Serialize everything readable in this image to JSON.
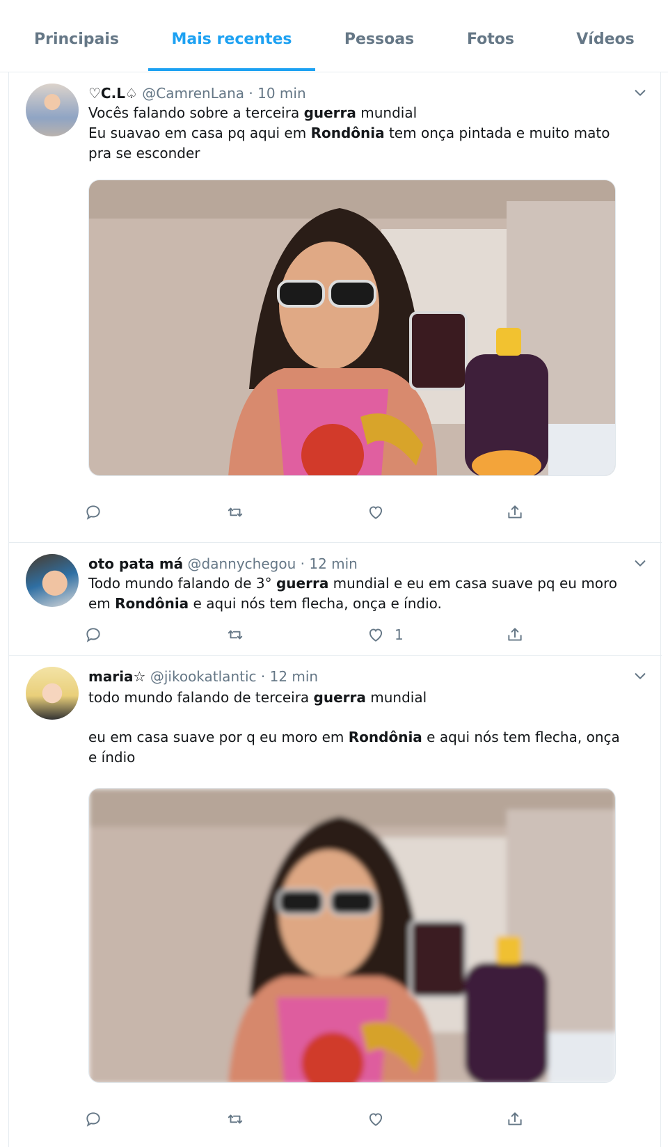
{
  "tabs": [
    {
      "label": "Principais",
      "active": false
    },
    {
      "label": "Mais recentes",
      "active": true
    },
    {
      "label": "Pessoas",
      "active": false
    },
    {
      "label": "Fotos",
      "active": false
    },
    {
      "label": "Vídeos",
      "active": false
    }
  ],
  "tweets": [
    {
      "name": "♡C.L♤",
      "handle": "@CamrenLana",
      "time": "· 10 min",
      "lines": [
        [
          "Vocês falando sobre a  terceira ",
          "guerra",
          " mundial"
        ],
        [
          " Eu suavao em casa pq aqui em ",
          "Rondônia",
          " tem onça pintada e muito mato"
        ],
        [
          "pra se esconder",
          "",
          ""
        ]
      ],
      "likes": ""
    },
    {
      "name": "oto pata má",
      "handle": "@dannychegou",
      "time": "· 12 min",
      "lines": [
        [
          "Todo mundo falando de 3° ",
          "guerra",
          " mundial e eu em casa suave pq eu moro"
        ],
        [
          "em ",
          "Rondônia",
          " e aqui nós tem flecha, onça e índio."
        ]
      ],
      "likes": "1"
    },
    {
      "name": "maria☆",
      "handle": "@jikookatlantic",
      "time": "· 12 min",
      "lines": [
        [
          "todo mundo falando de terceira ",
          "guerra",
          " mundial"
        ],
        [
          "",
          "",
          ""
        ],
        [
          "eu em casa suave por q eu moro em ",
          "Rondônia",
          " e aqui nós tem flecha, onça"
        ],
        [
          "e índio",
          "",
          ""
        ]
      ],
      "likes": ""
    }
  ],
  "icons": [
    "reply-icon",
    "retweet-icon",
    "like-icon",
    "share-icon",
    "chevron-down-icon"
  ],
  "colors": {
    "accent": "#1da1f2",
    "muted": "#657786",
    "border": "#e6ecf0"
  }
}
